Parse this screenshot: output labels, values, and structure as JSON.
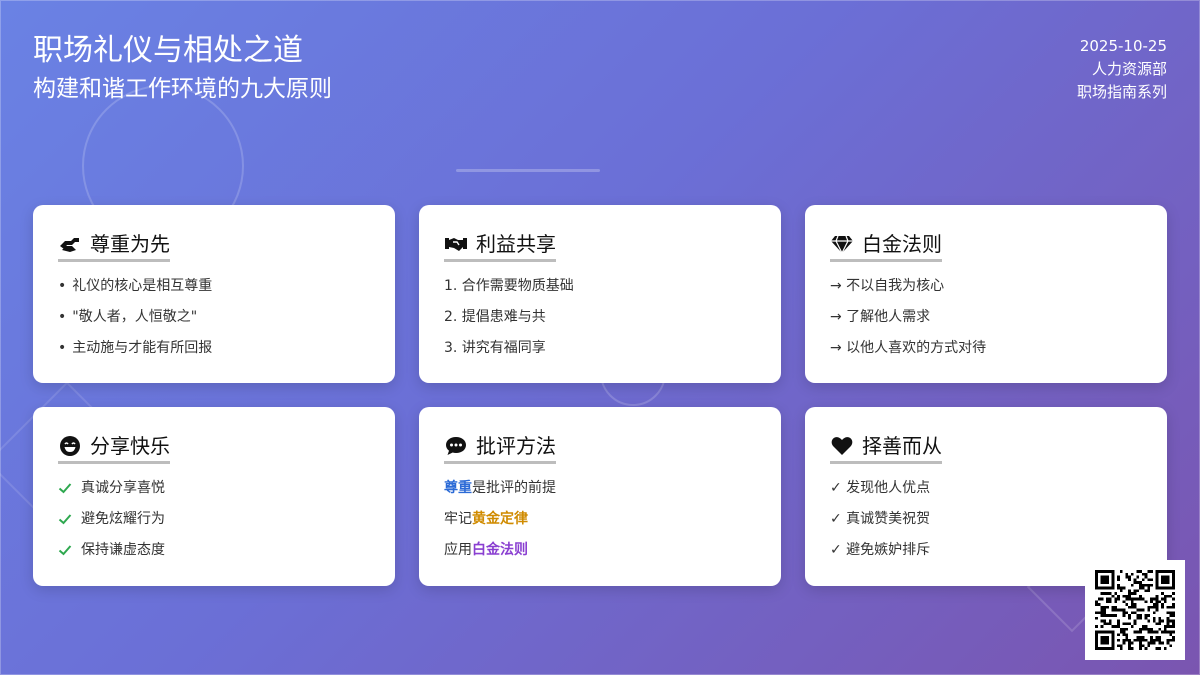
{
  "header": {
    "title": "职场礼仪与相处之道",
    "subtitle": "构建和谐工作环境的九大原则"
  },
  "meta": {
    "date": "2025-10-25",
    "department": "人力资源部",
    "series": "职场指南系列"
  },
  "cards": [
    {
      "icon": "handshake-hand-icon",
      "title": "尊重为先",
      "items": [
        "礼仪的核心是相互尊重",
        "\"敬人者，人恒敬之\"",
        "主动施与才能有所回报"
      ]
    },
    {
      "icon": "handshake-icon",
      "title": "利益共享",
      "items": [
        "1. 合作需要物质基础",
        "2. 提倡患难与共",
        "3. 讲究有福同享"
      ]
    },
    {
      "icon": "gem-icon",
      "title": "白金法则",
      "items": [
        "→ 不以自我为核心",
        "→ 了解他人需求",
        "→ 以他人喜欢的方式对待"
      ]
    },
    {
      "icon": "smile-icon",
      "title": "分享快乐",
      "items": [
        "真诚分享喜悦",
        "避免炫耀行为",
        "保持谦虚态度"
      ]
    },
    {
      "icon": "comment-dots-icon",
      "title": "批评方法",
      "items": [
        {
          "highlight": "尊重",
          "after": "是批评的前提"
        },
        {
          "before": "牢记",
          "highlight": "黄金定律"
        },
        {
          "before": "应用",
          "highlight": "白金法则"
        }
      ]
    },
    {
      "icon": "heart-icon",
      "title": "择善而从",
      "items": [
        "✓ 发现他人优点",
        "✓ 真诚赞美祝贺",
        "✓ 避免嫉妒排斥"
      ]
    }
  ],
  "colors": {
    "check": "#2ea84f",
    "highlight_blue": "#2c6bd6",
    "highlight_gold": "#d08b00",
    "highlight_purple": "#8a3fd1"
  }
}
